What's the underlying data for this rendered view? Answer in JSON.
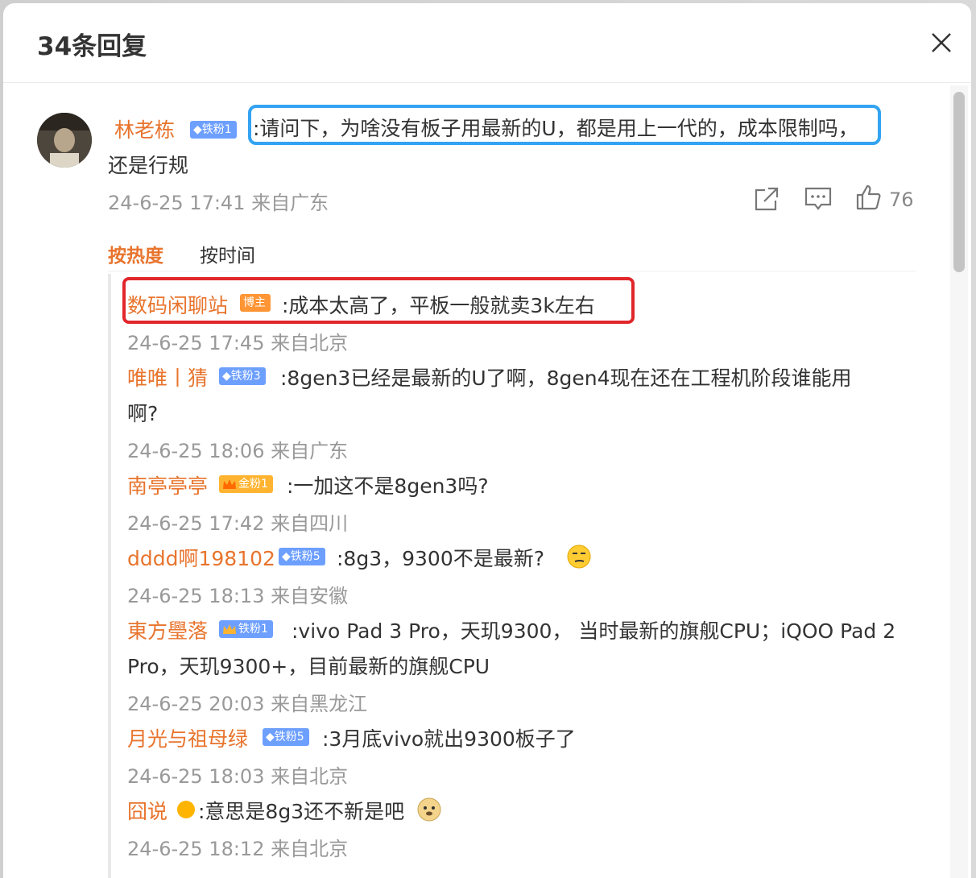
{
  "dialog": {
    "title": "34条回复"
  },
  "main_comment": {
    "author": "林老栋",
    "badge": "铁粉1",
    "text_line1": ":请问下，为啥没有板子用最新的U，都是用上一代的，成本限制吗，",
    "text_line2": "还是行规",
    "meta": "24-6-25 17:41 来自广东",
    "likes": "76"
  },
  "sort": {
    "hot": "按热度",
    "time": "按时间"
  },
  "replies": [
    {
      "author": "数码闲聊站",
      "badge": "博主",
      "text": ":成本太高了，平板一般就卖3k左右",
      "meta": "24-6-25 17:45 来自北京"
    },
    {
      "author": "唯唯丨猜",
      "badge": "铁粉3",
      "text_line1": ":8gen3已经是最新的U了啊，8gen4现在还在工程机阶段谁能用",
      "text_line2": "啊?",
      "meta": "24-6-25 18:06 来自广东"
    },
    {
      "author": "南亭亭亭",
      "badge": "金粉1",
      "text": ":一加这不是8gen3吗?",
      "meta": "24-6-25 17:42 来自四川"
    },
    {
      "author": "dddd啊198102",
      "badge": "铁粉5",
      "text": ":8g3，9300不是最新?",
      "meta": "24-6-25 18:13 来自安徽"
    },
    {
      "author": "東方璺落",
      "badge": "铁粉1",
      "text_line1": ":vivo Pad 3 Pro，天玑9300， 当时最新的旗舰CPU；iQOO Pad 2",
      "text_line2": "Pro，天玑9300+，目前最新的旗舰CPU",
      "meta": "24-6-25 20:03 来自黑龙江"
    },
    {
      "author": "月光与祖母绿",
      "badge": "铁粉5",
      "text": ":3月底vivo就出9300板子了",
      "meta": "24-6-25 18:03 来自北京"
    },
    {
      "author": "囧说",
      "text": ":意思是8g3还不新是吧",
      "meta": "24-6-25 18:12 来自北京"
    }
  ],
  "colors": {
    "accent": "#e8742d",
    "highlight_blue": "#33a3f2",
    "highlight_red": "#e1262b"
  }
}
